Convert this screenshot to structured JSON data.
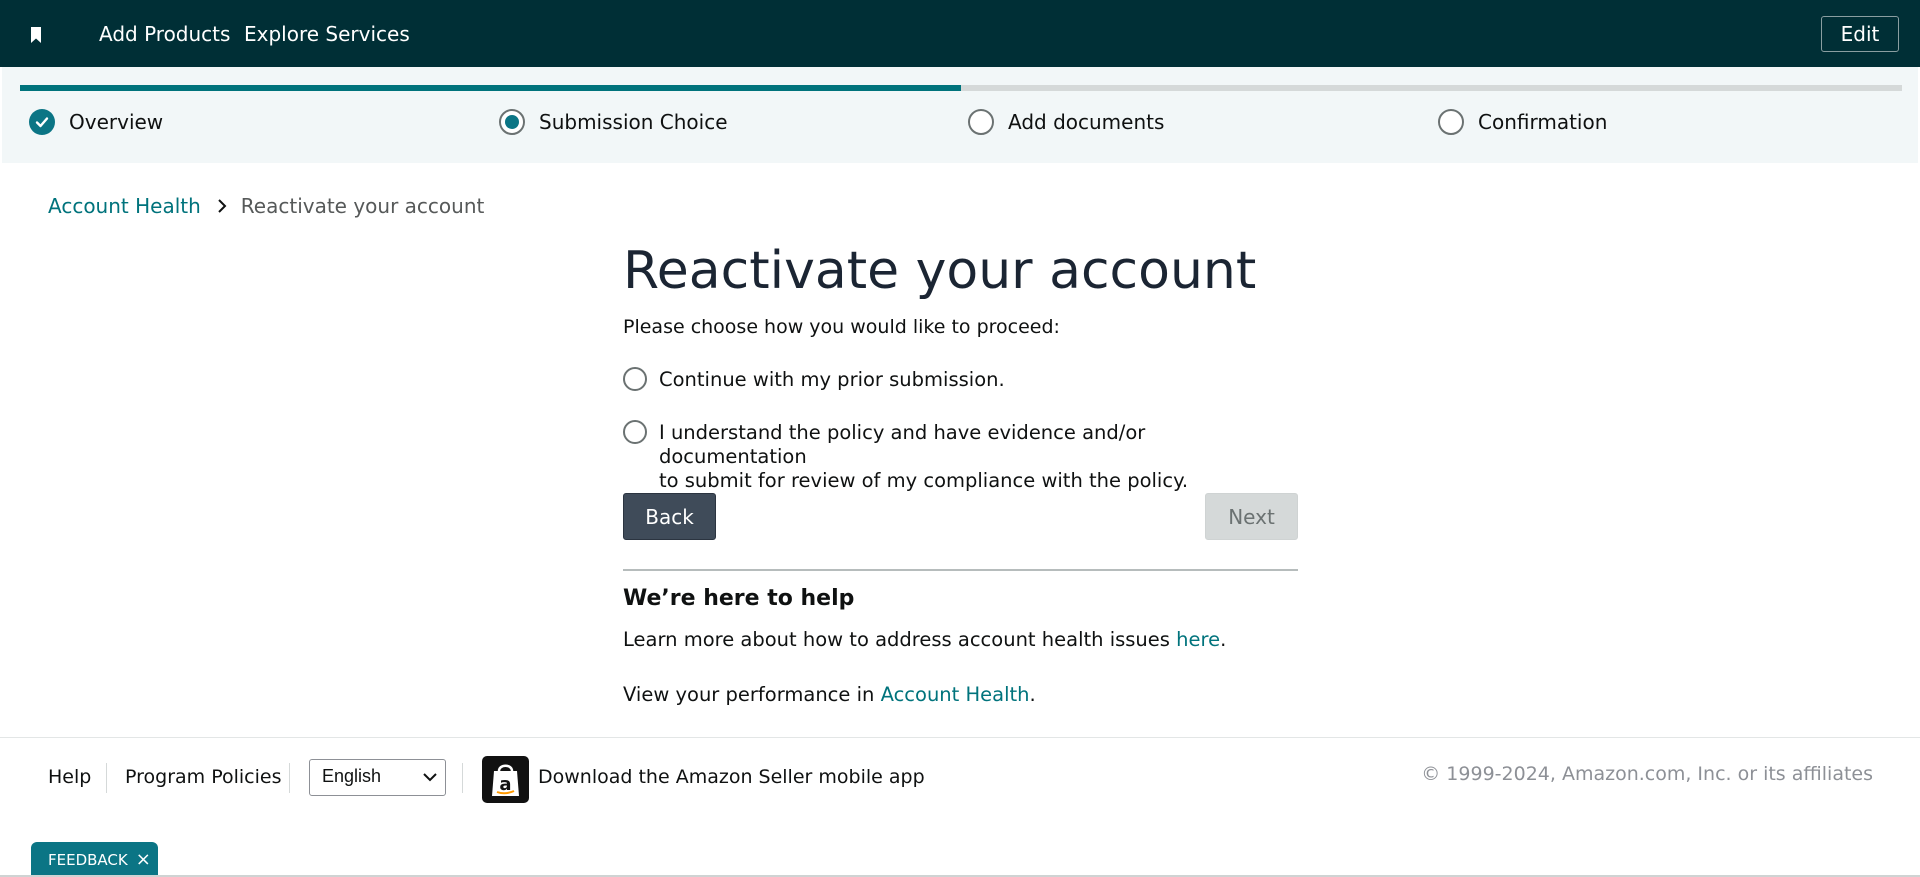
{
  "topbar": {
    "bookmark_icon": "bookmark-icon",
    "nav": [
      {
        "label": "Add Products"
      },
      {
        "label": "Explore Services"
      }
    ],
    "edit_label": "Edit",
    "background": "#002f36"
  },
  "stepper": {
    "progress_percent": 50,
    "steps": [
      {
        "label": "Overview",
        "state": "complete"
      },
      {
        "label": "Submission Choice",
        "state": "current"
      },
      {
        "label": "Add documents",
        "state": "upcoming"
      },
      {
        "label": "Confirmation",
        "state": "upcoming"
      }
    ],
    "accent": "#0b7585"
  },
  "breadcrumb": {
    "parent": "Account Health",
    "current": "Reactivate your account"
  },
  "main": {
    "title": "Reactivate your account",
    "prompt": "Please choose how you would like to proceed:",
    "options": [
      {
        "label": "Continue with my prior submission.",
        "selected": false
      },
      {
        "label_line1": "I understand the policy and have evidence and/or documentation",
        "label_line2": "to submit for review of my compliance with the policy.",
        "selected": false
      }
    ],
    "back_label": "Back",
    "next_label": "Next",
    "next_disabled": true
  },
  "help": {
    "title": "We’re here to help",
    "line1_text": "Learn more about how to address account health issues ",
    "line1_link": "here",
    "line1_end": ".",
    "line2_text": "View your performance in ",
    "line2_link": "Account Health",
    "line2_end": "."
  },
  "footer": {
    "help": "Help",
    "policies": "Program Policies",
    "language": "English",
    "app_icon": "amazon-seller-app-icon",
    "app_icon_letter": "a",
    "app_text": "Download the Amazon Seller mobile app",
    "copyright": "© 1999-2024, Amazon.com, Inc. or its affiliates"
  },
  "feedback": {
    "label": "FEEDBACK",
    "close": "×"
  }
}
